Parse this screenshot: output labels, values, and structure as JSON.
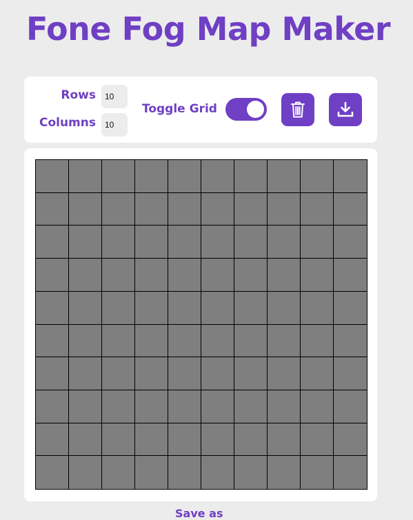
{
  "header": {
    "title": "Fone Fog Map Maker"
  },
  "toolbar": {
    "rows_label": "Rows",
    "rows_value": "10",
    "columns_label": "Columns",
    "columns_value": "10",
    "toggle_grid_label": "Toggle Grid",
    "toggle_grid_on": true,
    "clear_icon": "trash-icon",
    "download_icon": "download-icon"
  },
  "map": {
    "rows": 10,
    "columns": 10,
    "fog_color": "#7f7f7f",
    "grid_line_color": "#000000"
  },
  "footer": {
    "save_as_label": "Save as"
  },
  "theme": {
    "accent": "#6f3fc4",
    "background": "#ececec",
    "card": "#ffffff"
  }
}
